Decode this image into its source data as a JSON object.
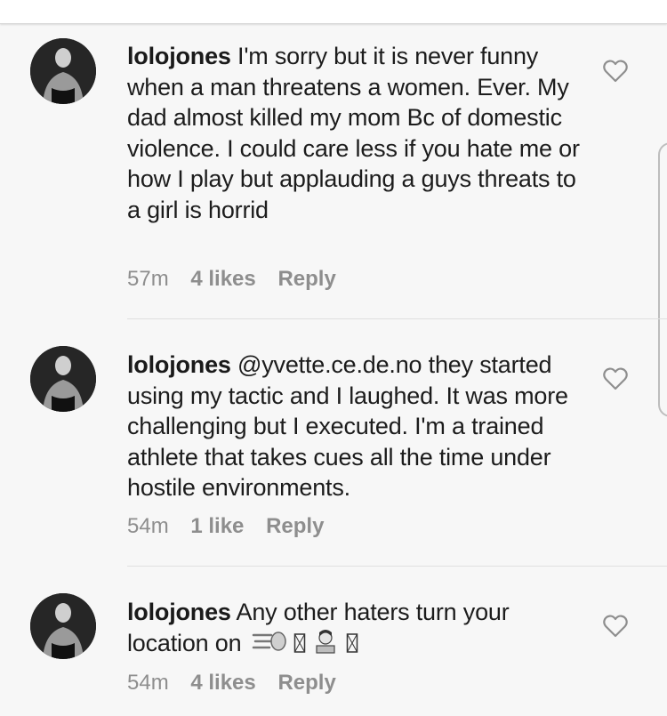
{
  "comments": [
    {
      "username": "lolojones",
      "text": "I'm sorry but it is never funny when a man threatens a women. Ever. My dad almost killed my mom Bc of domestic violence. I could care less if you hate me or how I play but applauding a guys threats to a girl is horrid",
      "time": "57m",
      "likes": "4 likes",
      "reply": "Reply"
    },
    {
      "username": "lolojones",
      "text": "@yvette.ce.de.no they started using my tactic and I laughed. It was more challenging but I executed. I'm a trained athlete that takes cues all the time under hostile environments.",
      "time": "54m",
      "likes": "1 like",
      "reply": "Reply"
    },
    {
      "username": "lolojones",
      "text": "Any other haters turn your location on",
      "time": "54m",
      "likes": "4 likes",
      "reply": "Reply"
    }
  ],
  "icons": {
    "like": "heart-outline-icon",
    "emojis": [
      "dashing-away-icon",
      "woman-technologist-icon"
    ]
  },
  "colors": {
    "meta_text": "#8e8e8e",
    "body_text": "#1c1c1c",
    "divider": "#e0e0e0"
  }
}
